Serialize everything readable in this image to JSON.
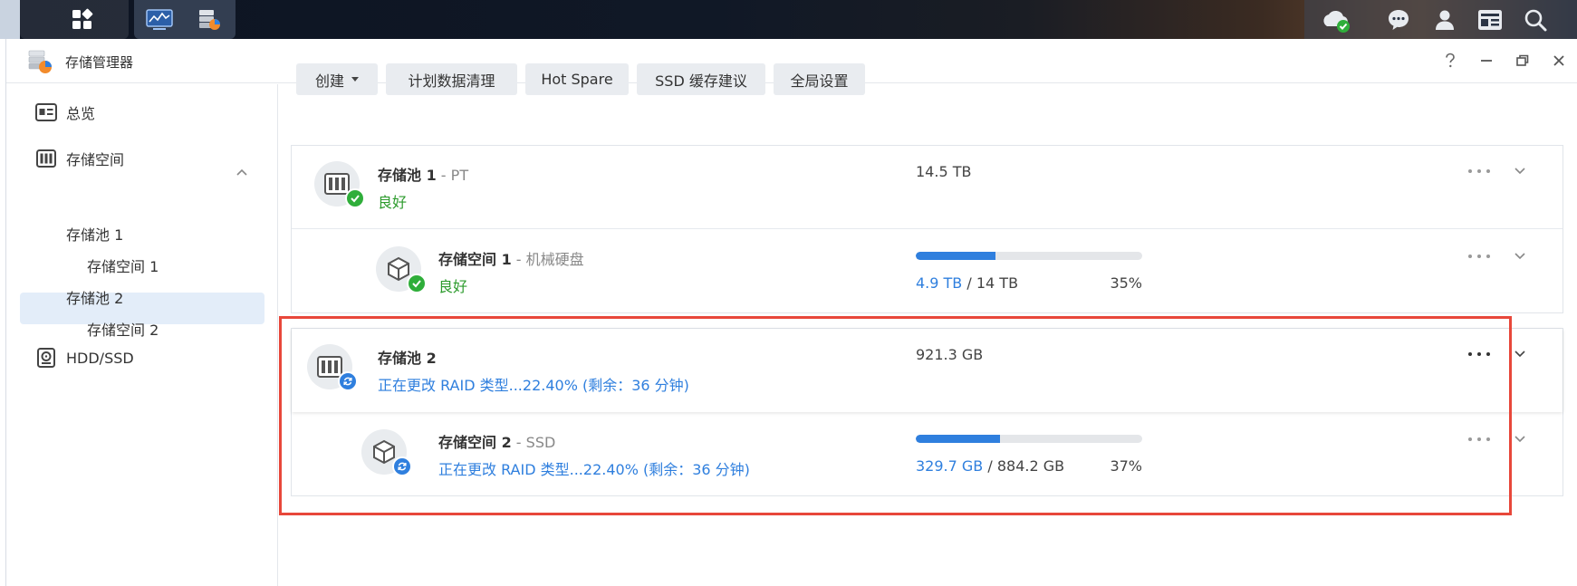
{
  "taskbar": {
    "left_icons": [
      "app-grid-icon",
      "resource-monitor-icon",
      "storage-manager-icon"
    ],
    "right_icons": [
      "cloud-sync-icon",
      "chat-icon",
      "user-icon",
      "widgets-icon",
      "search-icon"
    ]
  },
  "window": {
    "title": "存储管理器",
    "controls": [
      "help-icon",
      "minimize-icon",
      "maximize-icon",
      "close-icon"
    ]
  },
  "sidebar": {
    "overview": "总览",
    "storage": "存储空间",
    "pool1": "存储池 1",
    "volume1": "存储空间 1",
    "pool2": "存储池 2",
    "volume2": "存储空间 2",
    "hdd": "HDD/SSD"
  },
  "toolbar": {
    "create": "创建",
    "scrub": "计划数据清理",
    "hotspare": "Hot Spare",
    "ssd_cache": "SSD 缓存建议",
    "global": "全局设置"
  },
  "pools": [
    {
      "name": "存储池 1",
      "sep": " - ",
      "desc": "PT",
      "status": "良好",
      "status_type": "good",
      "capacity": "14.5 TB",
      "volume": {
        "name": "存储空间 1",
        "sep": " - ",
        "desc": "机械硬盘",
        "status": "良好",
        "status_type": "good",
        "used": "4.9 TB",
        "slash": " / ",
        "total": "14 TB",
        "percent_label": "35%",
        "percent": 35
      }
    },
    {
      "name": "存储池 2",
      "sep": "",
      "desc": "",
      "status": "正在更改 RAID 类型...22.40% (剩余：36 分钟)",
      "status_type": "progress",
      "capacity": "921.3 GB",
      "volume": {
        "name": "存储空间 2",
        "sep": " - ",
        "desc": "SSD",
        "status": "正在更改 RAID 类型...22.40% (剩余：36 分钟)",
        "status_type": "progress",
        "used": "329.7 GB",
        "slash": " / ",
        "total": "884.2 GB",
        "percent_label": "37%",
        "percent": 37
      }
    }
  ],
  "colors": {
    "accent": "#2f7fde",
    "good": "#2d9b2d",
    "highlight": "#e8473a"
  }
}
